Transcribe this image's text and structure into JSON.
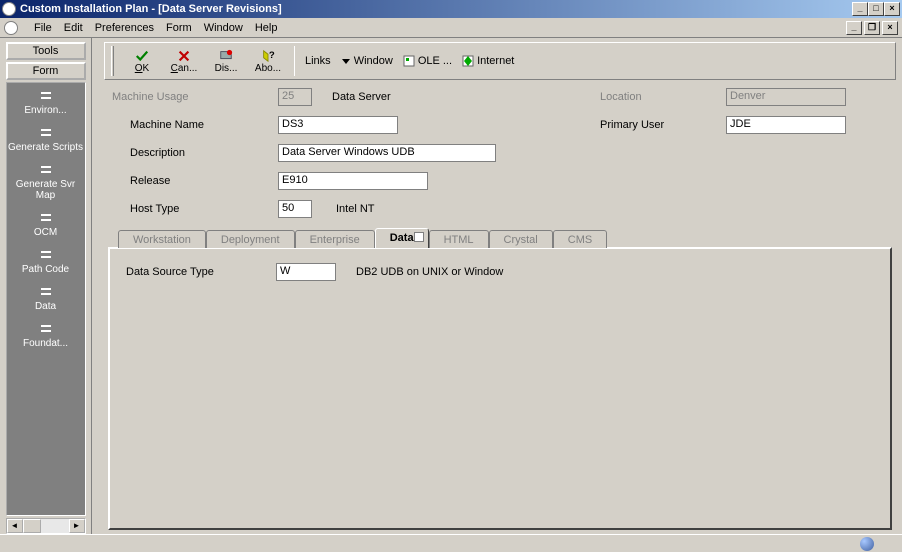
{
  "title": "Custom Installation Plan - [Data Server Revisions]",
  "menus": [
    "File",
    "Edit",
    "Preferences",
    "Form",
    "Window",
    "Help"
  ],
  "toolbar": {
    "ok": "OK",
    "cancel": "Can...",
    "display": "Dis...",
    "about": "Abo...",
    "links_label": "Links",
    "links": [
      "Window",
      "OLE ...",
      "Internet"
    ]
  },
  "left": {
    "btn_tools": "Tools",
    "btn_form": "Form",
    "items": [
      "Environ...",
      "Generate Scripts",
      "Generate Svr Map",
      "OCM",
      "Path Code",
      "Data",
      "Foundat..."
    ]
  },
  "form": {
    "machine_usage_label": "Machine Usage",
    "machine_usage_value": "25",
    "machine_usage_desc": "Data Server",
    "location_label": "Location",
    "location_value": "Denver",
    "machine_name_label": "Machine Name",
    "machine_name_value": "DS3",
    "primary_user_label": "Primary User",
    "primary_user_value": "JDE",
    "description_label": "Description",
    "description_value": "Data Server Windows UDB",
    "release_label": "Release",
    "release_value": "E910",
    "host_type_label": "Host Type",
    "host_type_value": "50",
    "host_type_desc": "Intel NT"
  },
  "tabs": {
    "workstation": "Workstation",
    "deployment": "Deployment",
    "enterprise": "Enterprise",
    "data": "Data",
    "html": "HTML",
    "crystal": "Crystal",
    "cms": "CMS",
    "active": "data",
    "content": {
      "ds_type_label": "Data Source Type",
      "ds_type_value": "W",
      "ds_type_desc": "DB2 UDB on UNIX or Window"
    }
  }
}
